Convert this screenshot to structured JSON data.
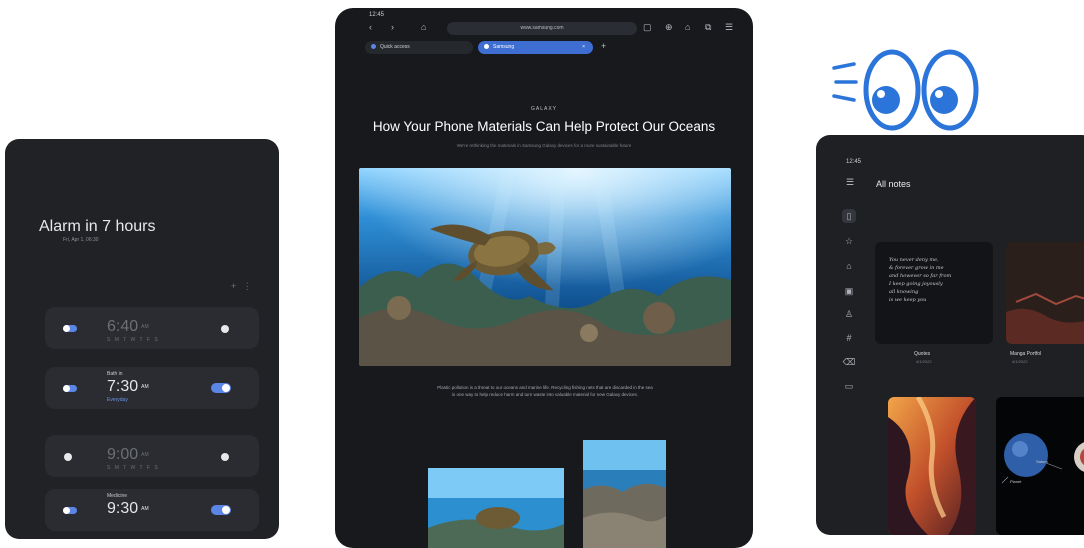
{
  "clock": {
    "header": "Alarm in 7 hours",
    "subheader": "Fri, Apr 1, 06:30",
    "toolbar": "+ ⋮",
    "alarms": [
      {
        "name": "",
        "time": "6:40",
        "ampm": "AM",
        "days": "S M T W T F S",
        "enabled": false,
        "repeat": ""
      },
      {
        "name": "Bath in",
        "time": "7:30",
        "ampm": "AM",
        "days": "",
        "enabled": true,
        "repeat": "Everyday"
      },
      {
        "name": "",
        "time": "9:00",
        "ampm": "AM",
        "days": "S M T W T F S",
        "enabled": false,
        "repeat": ""
      },
      {
        "name": "Medicine",
        "time": "9:30",
        "ampm": "AM",
        "days": "",
        "enabled": true,
        "repeat": ""
      }
    ]
  },
  "browser": {
    "status_time": "12:45",
    "url": "www.samsung.com",
    "tabs": [
      {
        "label": "Quick access",
        "active": false
      },
      {
        "label": "Samsung",
        "active": true
      }
    ],
    "article": {
      "eyebrow": "GALAXY",
      "title": "How Your Phone Materials Can Help Protect Our Oceans",
      "subtitle": "We're rethinking the materials in Samsung Galaxy devices for a more sustainable future",
      "body": "Plastic pollution is a threat to our oceans and marine life. Recycling fishing nets that are discarded in the sea is one way to help reduce harm and turn waste into valuable material for new Galaxy devices."
    }
  },
  "notes": {
    "status_time": "12:45",
    "title": "All notes",
    "handwriting": [
      "You never deny me,",
      "& forever grow in me",
      "and however so far from",
      "I keep going joyously",
      "all knowing",
      "is we keep you"
    ],
    "cards": [
      {
        "label": "Quotes",
        "date": "4/1/2022"
      },
      {
        "label": "Manga Portfol",
        "date": "4/1/2022"
      }
    ],
    "space_labels": [
      "Saturn",
      "Planet"
    ]
  },
  "colors": {
    "accent": "#3e6ed2",
    "device": "#1b1d22",
    "eyes": "#2b74d9"
  }
}
